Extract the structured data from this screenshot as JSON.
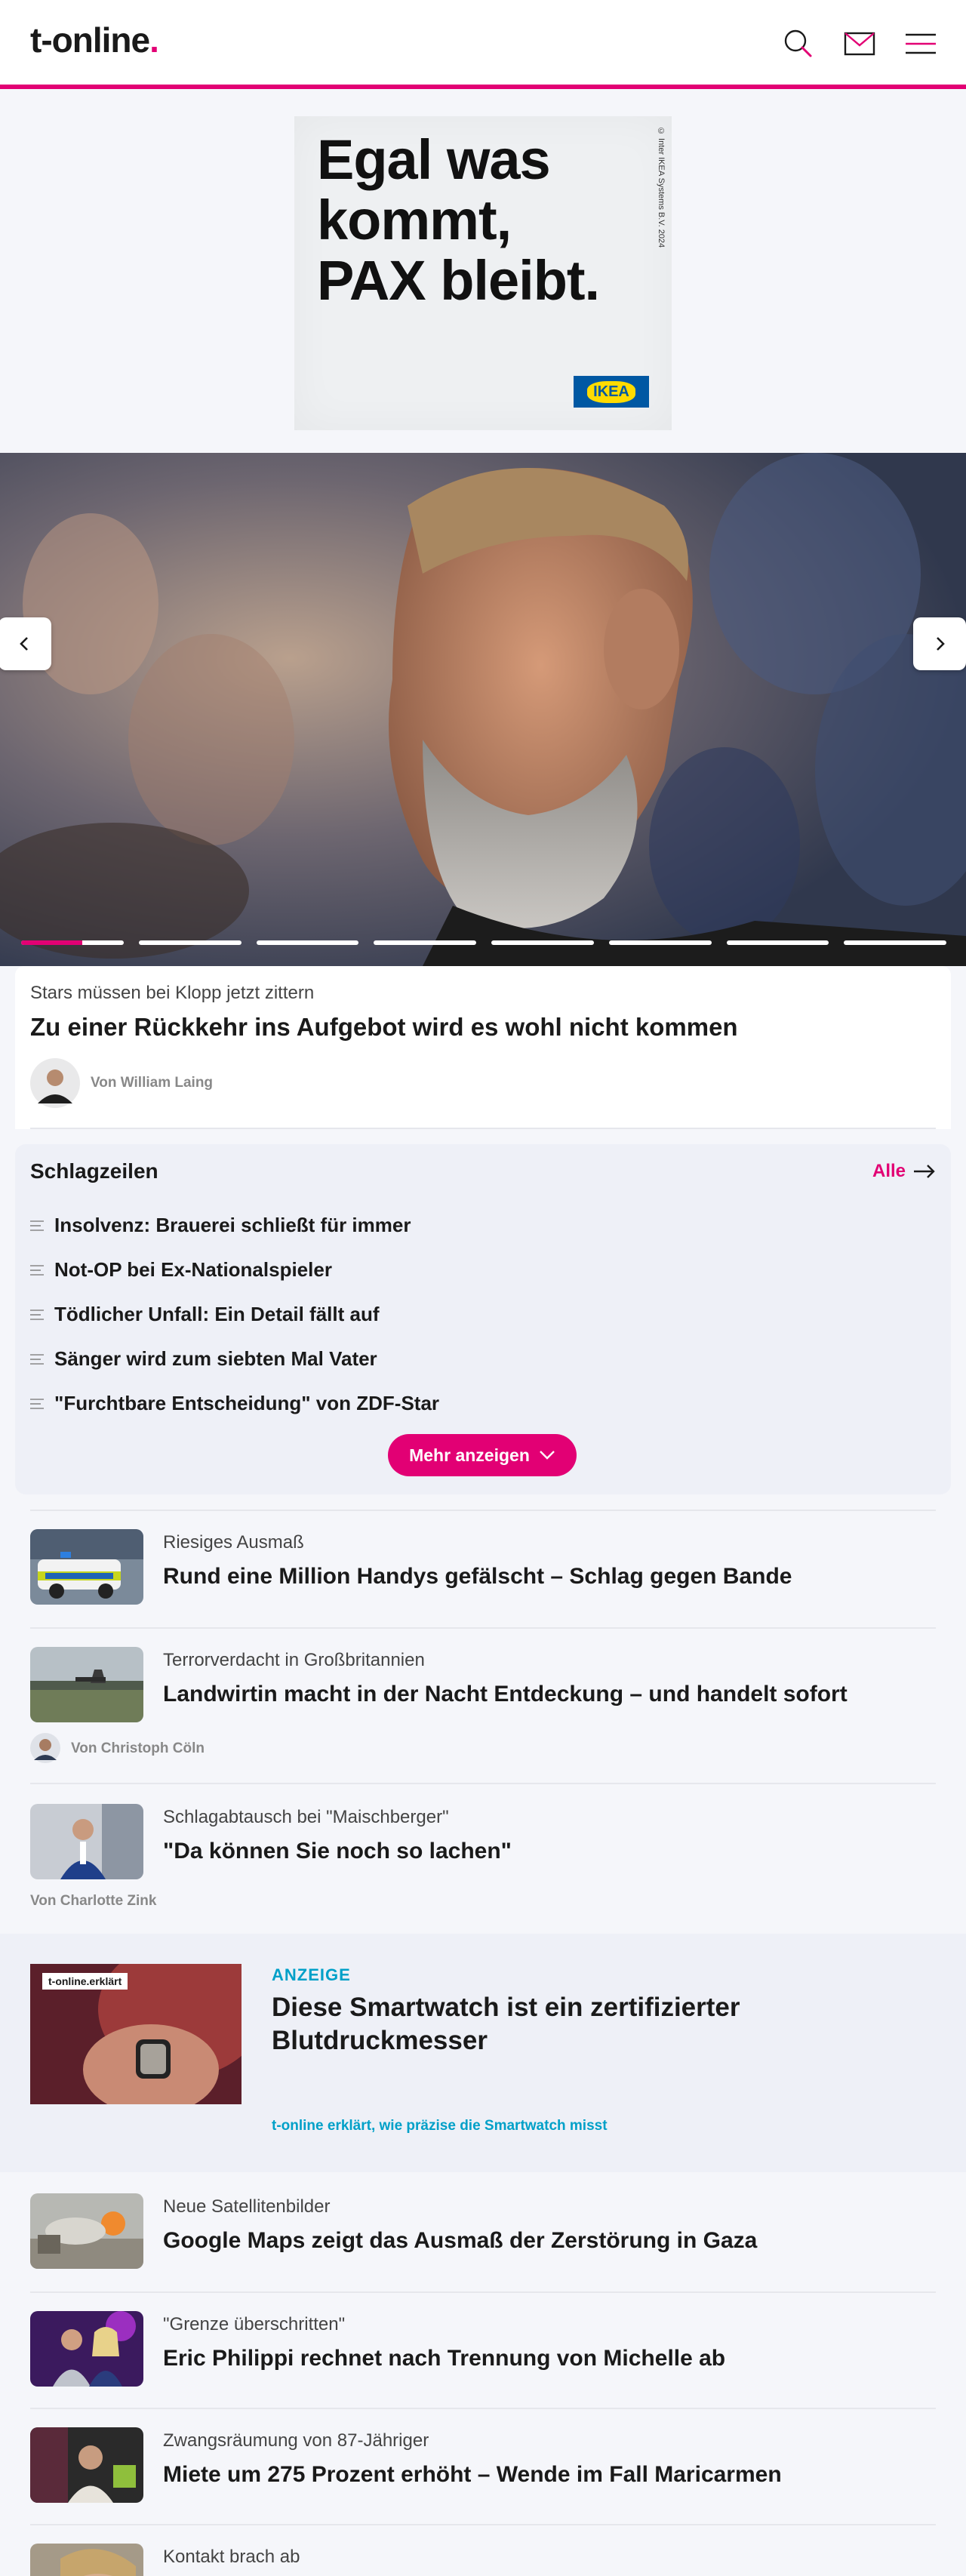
{
  "header": {
    "logo_main": "t-online",
    "logo_dot": ".",
    "icons": [
      "search-icon",
      "mail-icon",
      "menu-icon"
    ],
    "accent_color": "#e20074"
  },
  "ad": {
    "headline": "Egal was\nkommt,\nPAX bleibt.",
    "copyright": "© Inter IKEA Systems B.V. 2024",
    "brand": "IKEA"
  },
  "hero": {
    "slides_total": 8,
    "active_slide_progress": 0.6,
    "kicker": "Stars müssen bei Klopp jetzt zittern",
    "title": "Zu einer Rückkehr ins Aufgebot wird es wohl nicht kommen",
    "author": "Von William Laing"
  },
  "schlagzeilen": {
    "title": "Schlagzeilen",
    "all_label": "Alle",
    "items": [
      "Insolvenz: Brauerei schließt für immer",
      "Not-OP bei Ex-Nationalspieler",
      "Tödlicher Unfall: Ein Detail fällt auf",
      "Sänger wird zum siebten Mal Vater",
      "\"Furchtbare Entscheidung\" von ZDF-Star"
    ],
    "more_label": "Mehr anzeigen"
  },
  "articles": [
    {
      "kicker": "Riesiges Ausmaß",
      "title": "Rund eine Million Handys gefälscht – Schlag gegen Bande",
      "author": ""
    },
    {
      "kicker": "Terrorverdacht in Großbritannien",
      "title": "Landwirtin macht in der Nacht Entdeckung – und handelt sofort",
      "author": "Von Christoph Cöln"
    },
    {
      "kicker": "Schlagabtausch bei \"Maischberger\"",
      "title": "\"Da können Sie noch so lachen\"",
      "author": "Von Charlotte Zink"
    }
  ],
  "anzeige": {
    "badge": "t-online.erklärt",
    "label": "ANZEIGE",
    "title": "Diese Smartwatch ist ein zertifizierter Blutdruckmesser",
    "link": "t-online erklärt, wie präzise die Smartwatch misst"
  },
  "articles2": [
    {
      "kicker": "Neue Satellitenbilder",
      "title": "Google Maps zeigt das Ausmaß der Zerstörung in Gaza"
    },
    {
      "kicker": "\"Grenze überschritten\"",
      "title": "Eric Philippi rechnet nach Trennung von Michelle ab"
    },
    {
      "kicker": "Zwangsräumung von 87-Jähriger",
      "title": "Miete um 275 Prozent erhöht – Wende im Fall Maricarmen"
    },
    {
      "kicker": "Kontakt brach ab",
      "title": ""
    }
  ]
}
